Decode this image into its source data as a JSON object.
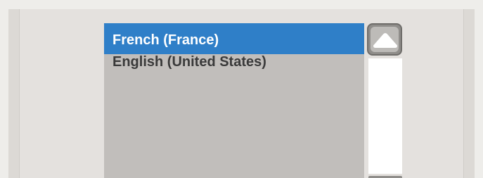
{
  "languages": {
    "items": [
      {
        "label": "French (France)",
        "selected": true
      },
      {
        "label": "English (United States)",
        "selected": false
      }
    ]
  },
  "colors": {
    "selection": "#2f7fc8",
    "list_background": "#c1bebb",
    "panel_background": "#e4e1de"
  },
  "icons": {
    "scroll_up": "chevron-up-icon"
  }
}
